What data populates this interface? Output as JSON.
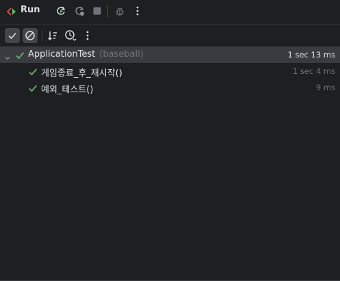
{
  "header": {
    "title": "Run",
    "icons": [
      "run-tool-icon",
      "rerun-icon",
      "rerun-failed-icon",
      "stop-icon",
      "debug-icon",
      "more-options-icon"
    ]
  },
  "toolbar": {
    "items": [
      "show-passed-icon",
      "show-ignored-icon",
      "sort-alphabetically-icon",
      "sort-by-duration-icon",
      "more-options-icon"
    ]
  },
  "tree": {
    "root": {
      "name": "ApplicationTest",
      "package": "(baseball)",
      "duration": "1 sec 13 ms"
    },
    "tests": [
      {
        "name": "게임종료_후_재시작()",
        "duration": "1 sec 4 ms"
      },
      {
        "name": "예외_테스트()",
        "duration": "9 ms"
      }
    ]
  },
  "colors": {
    "background": "#1e1f22",
    "selected_row": "#393b40",
    "pass_green": "#5fb865",
    "muted_text": "#6f737a",
    "text": "#dfe1e5"
  }
}
